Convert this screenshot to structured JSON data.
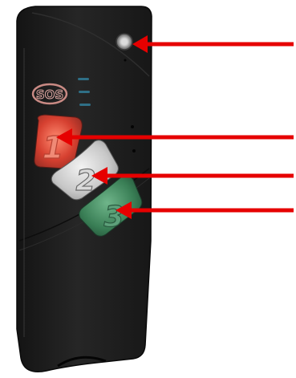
{
  "device": {
    "sos_label": "SOS",
    "buttons": [
      {
        "label": "1",
        "color": "#d94a3a"
      },
      {
        "label": "2",
        "color": "#c9c9c9"
      },
      {
        "label": "3",
        "color": "#3e8a5c"
      }
    ],
    "body_color": "#1f1f1f",
    "led_color": "#2f6f86"
  },
  "annotations": {
    "arrow_color": "#e60000",
    "arrow_count": 4
  }
}
